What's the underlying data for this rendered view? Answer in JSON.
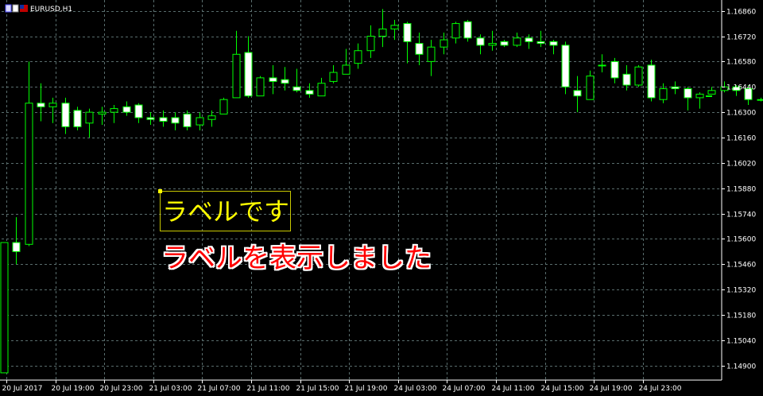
{
  "symbol": {
    "label": "EURUSD,H1"
  },
  "labels": {
    "box_text": "ラベルです",
    "red_text": "ラベルを表示しました"
  },
  "colors": {
    "background": "#000000",
    "bull_body": "#000000",
    "bear_body": "#ffffff",
    "wick": "#00ff00",
    "grid": "#596d6d",
    "axis_text": "#ffffff",
    "label_box_text": "#ffff00",
    "label_red_text": "#ff0000"
  },
  "chart_data": {
    "type": "candlestick",
    "symbol": "EURUSD",
    "timeframe": "H1",
    "grid": true,
    "ylim": [
      1.1482,
      1.1692
    ],
    "y_ticks": [
      "1.16860",
      "1.16720",
      "1.16580",
      "1.16440",
      "1.16300",
      "1.16160",
      "1.16020",
      "1.15880",
      "1.15740",
      "1.15600",
      "1.15460",
      "1.15320",
      "1.15180",
      "1.15040",
      "1.14900"
    ],
    "x_ticks": [
      "20 Jul 2017",
      "20 Jul 19:00",
      "20 Jul 23:00",
      "21 Jul 03:00",
      "21 Jul 07:00",
      "21 Jul 11:00",
      "21 Jul 15:00",
      "21 Jul 19:00",
      "24 Jul 03:00",
      "24 Jul 07:00",
      "24 Jul 11:00",
      "24 Jul 15:00",
      "24 Jul 19:00",
      "24 Jul 23:00"
    ],
    "candles": [
      {
        "o": 1.1486,
        "h": 1.1558,
        "l": 1.1486,
        "c": 1.1558
      },
      {
        "o": 1.1558,
        "h": 1.1572,
        "l": 1.1546,
        "c": 1.1553
      },
      {
        "o": 1.1557,
        "h": 1.1658,
        "l": 1.1556,
        "c": 1.1635
      },
      {
        "o": 1.1635,
        "h": 1.1646,
        "l": 1.1625,
        "c": 1.1633
      },
      {
        "o": 1.1633,
        "h": 1.1638,
        "l": 1.1624,
        "c": 1.1635
      },
      {
        "o": 1.1635,
        "h": 1.1638,
        "l": 1.1618,
        "c": 1.1622
      },
      {
        "o": 1.1631,
        "h": 1.1633,
        "l": 1.162,
        "c": 1.1622
      },
      {
        "o": 1.1624,
        "h": 1.1632,
        "l": 1.1616,
        "c": 1.163
      },
      {
        "o": 1.1629,
        "h": 1.1633,
        "l": 1.1623,
        "c": 1.163
      },
      {
        "o": 1.163,
        "h": 1.1634,
        "l": 1.1624,
        "c": 1.1632
      },
      {
        "o": 1.1633,
        "h": 1.1636,
        "l": 1.1628,
        "c": 1.163
      },
      {
        "o": 1.1634,
        "h": 1.1635,
        "l": 1.1624,
        "c": 1.1627
      },
      {
        "o": 1.1627,
        "h": 1.163,
        "l": 1.1623,
        "c": 1.1626
      },
      {
        "o": 1.1627,
        "h": 1.1631,
        "l": 1.1622,
        "c": 1.1625
      },
      {
        "o": 1.1627,
        "h": 1.163,
        "l": 1.162,
        "c": 1.1624
      },
      {
        "o": 1.1629,
        "h": 1.1631,
        "l": 1.162,
        "c": 1.1622
      },
      {
        "o": 1.1623,
        "h": 1.163,
        "l": 1.162,
        "c": 1.1627
      },
      {
        "o": 1.1626,
        "h": 1.1631,
        "l": 1.1622,
        "c": 1.1628
      },
      {
        "o": 1.1629,
        "h": 1.1638,
        "l": 1.1629,
        "c": 1.1637
      },
      {
        "o": 1.1638,
        "h": 1.1675,
        "l": 1.1638,
        "c": 1.1662
      },
      {
        "o": 1.1663,
        "h": 1.1672,
        "l": 1.1638,
        "c": 1.1639
      },
      {
        "o": 1.1639,
        "h": 1.165,
        "l": 1.1639,
        "c": 1.1649
      },
      {
        "o": 1.1649,
        "h": 1.1656,
        "l": 1.164,
        "c": 1.1647
      },
      {
        "o": 1.1648,
        "h": 1.1655,
        "l": 1.1642,
        "c": 1.1646
      },
      {
        "o": 1.1644,
        "h": 1.1654,
        "l": 1.1641,
        "c": 1.1642
      },
      {
        "o": 1.1642,
        "h": 1.1646,
        "l": 1.1638,
        "c": 1.164
      },
      {
        "o": 1.1639,
        "h": 1.1649,
        "l": 1.1639,
        "c": 1.1646
      },
      {
        "o": 1.1647,
        "h": 1.1656,
        "l": 1.1646,
        "c": 1.1652
      },
      {
        "o": 1.1651,
        "h": 1.1665,
        "l": 1.1651,
        "c": 1.1656
      },
      {
        "o": 1.1657,
        "h": 1.1668,
        "l": 1.1654,
        "c": 1.1664
      },
      {
        "o": 1.1664,
        "h": 1.1678,
        "l": 1.166,
        "c": 1.1672
      },
      {
        "o": 1.1672,
        "h": 1.1687,
        "l": 1.1666,
        "c": 1.1676
      },
      {
        "o": 1.1676,
        "h": 1.1681,
        "l": 1.167,
        "c": 1.1678
      },
      {
        "o": 1.1679,
        "h": 1.168,
        "l": 1.1657,
        "c": 1.1669
      },
      {
        "o": 1.1668,
        "h": 1.1674,
        "l": 1.1656,
        "c": 1.1662
      },
      {
        "o": 1.1658,
        "h": 1.167,
        "l": 1.165,
        "c": 1.1666
      },
      {
        "o": 1.1666,
        "h": 1.1674,
        "l": 1.1662,
        "c": 1.167
      },
      {
        "o": 1.1671,
        "h": 1.168,
        "l": 1.1668,
        "c": 1.1679
      },
      {
        "o": 1.168,
        "h": 1.1681,
        "l": 1.1669,
        "c": 1.1671
      },
      {
        "o": 1.1671,
        "h": 1.1673,
        "l": 1.1662,
        "c": 1.1667
      },
      {
        "o": 1.1667,
        "h": 1.1675,
        "l": 1.1664,
        "c": 1.1668
      },
      {
        "o": 1.1669,
        "h": 1.167,
        "l": 1.1666,
        "c": 1.1667
      },
      {
        "o": 1.1667,
        "h": 1.1674,
        "l": 1.1666,
        "c": 1.1671
      },
      {
        "o": 1.1671,
        "h": 1.1673,
        "l": 1.1665,
        "c": 1.1669
      },
      {
        "o": 1.1669,
        "h": 1.1675,
        "l": 1.1666,
        "c": 1.1668
      },
      {
        "o": 1.1669,
        "h": 1.167,
        "l": 1.1662,
        "c": 1.1667
      },
      {
        "o": 1.1667,
        "h": 1.1669,
        "l": 1.164,
        "c": 1.1644
      },
      {
        "o": 1.1642,
        "h": 1.165,
        "l": 1.163,
        "c": 1.1639
      },
      {
        "o": 1.1637,
        "h": 1.1653,
        "l": 1.1637,
        "c": 1.165
      },
      {
        "o": 1.1656,
        "h": 1.1662,
        "l": 1.1652,
        "c": 1.1656
      },
      {
        "o": 1.1658,
        "h": 1.166,
        "l": 1.1646,
        "c": 1.1649
      },
      {
        "o": 1.1651,
        "h": 1.1656,
        "l": 1.1642,
        "c": 1.1645
      },
      {
        "o": 1.1645,
        "h": 1.1656,
        "l": 1.1644,
        "c": 1.1655
      },
      {
        "o": 1.1656,
        "h": 1.1659,
        "l": 1.1636,
        "c": 1.1638
      },
      {
        "o": 1.1637,
        "h": 1.1646,
        "l": 1.1635,
        "c": 1.1643
      },
      {
        "o": 1.1644,
        "h": 1.1647,
        "l": 1.164,
        "c": 1.1643
      },
      {
        "o": 1.1643,
        "h": 1.1644,
        "l": 1.1631,
        "c": 1.1638
      },
      {
        "o": 1.1638,
        "h": 1.1641,
        "l": 1.1632,
        "c": 1.164
      },
      {
        "o": 1.164,
        "h": 1.1644,
        "l": 1.164,
        "c": 1.1642
      },
      {
        "o": 1.1642,
        "h": 1.1647,
        "l": 1.1641,
        "c": 1.1644
      },
      {
        "o": 1.1644,
        "h": 1.1645,
        "l": 1.1639,
        "c": 1.1642
      },
      {
        "o": 1.1643,
        "h": 1.1645,
        "l": 1.1634,
        "c": 1.1637
      },
      {
        "o": 1.1637,
        "h": 1.1638,
        "l": 1.1636,
        "c": 1.1637
      }
    ]
  }
}
